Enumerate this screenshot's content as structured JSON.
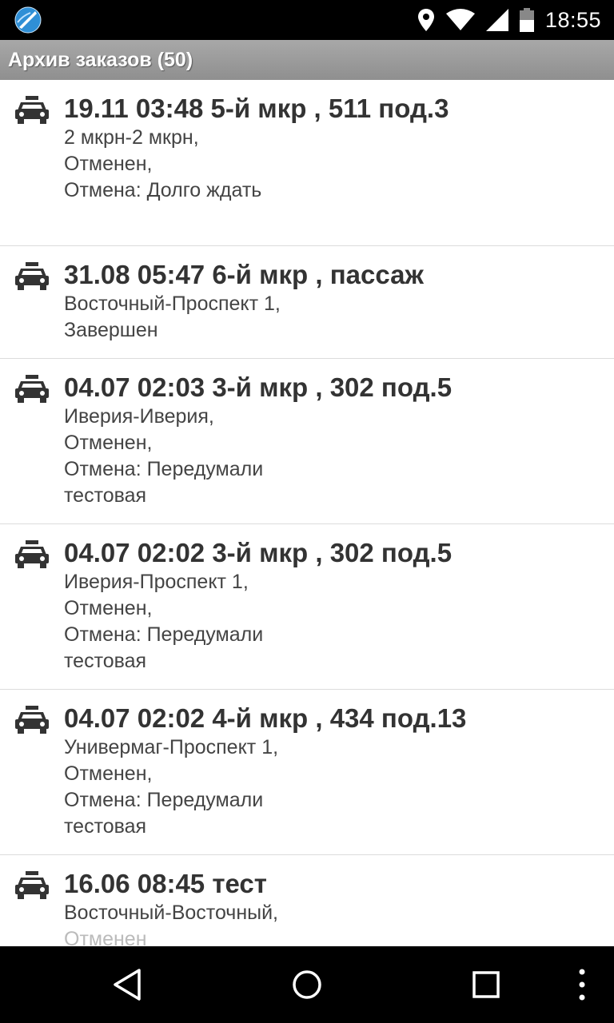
{
  "status_bar": {
    "time": "18:55",
    "icons": [
      "app-logo-icon",
      "location-pin-icon",
      "wifi-icon",
      "cell-signal-icon",
      "battery-icon"
    ]
  },
  "header": {
    "title": "Архив заказов (50)"
  },
  "orders": [
    {
      "title": "19.11 03:48 5-й мкр , 511 под.3",
      "lines": [
        "2 мкрн-2 мкрн,",
        "Отменен,",
        "Отмена: Долго ждать"
      ]
    },
    {
      "title": "31.08 05:47 6-й мкр , пассаж",
      "lines": [
        "Восточный-Проспект 1,",
        "Завершен"
      ]
    },
    {
      "title": "04.07 02:03 3-й мкр , 302 под.5",
      "lines": [
        "Иверия-Иверия,",
        "Отменен,",
        "Отмена: Передумали",
        "тестовая"
      ]
    },
    {
      "title": "04.07 02:02 3-й мкр , 302 под.5",
      "lines": [
        "Иверия-Проспект 1,",
        "Отменен,",
        "Отмена: Передумали",
        "тестовая"
      ]
    },
    {
      "title": "04.07 02:02 4-й мкр , 434 под.13",
      "lines": [
        "Универмаг-Проспект 1,",
        "Отменен,",
        "Отмена: Передумали",
        "тестовая"
      ]
    },
    {
      "title": "16.06 08:45 тест",
      "lines": [
        "Восточный-Восточный,",
        "Отменен"
      ]
    }
  ],
  "nav_bar": {
    "icons": [
      "back-icon",
      "home-icon",
      "recents-icon",
      "overflow-menu-icon"
    ]
  },
  "colors": {
    "title_bar": "#9a9a9a",
    "text_primary": "#333333",
    "divider": "#dcdcdc"
  }
}
